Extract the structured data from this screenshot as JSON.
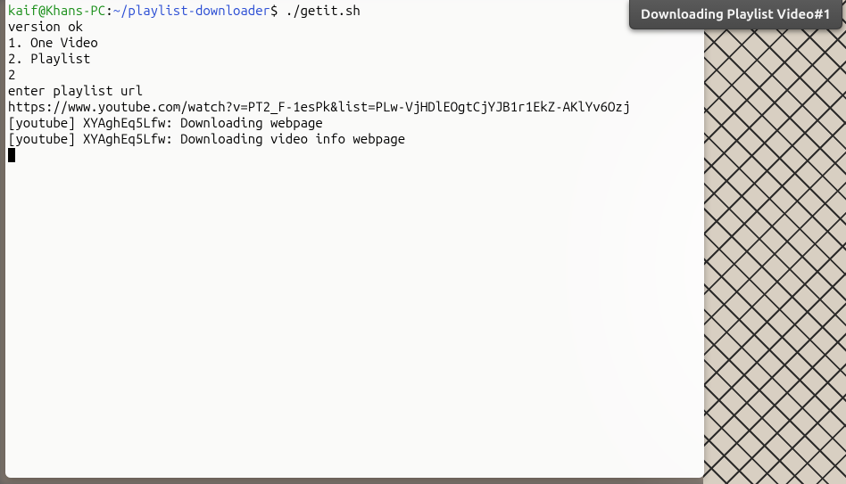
{
  "notification": {
    "title": "Downloading Playlist Video#1"
  },
  "terminal": {
    "prompt": {
      "user_host": "kaif@Khans-PC",
      "separator": ":",
      "path": "~/playlist-downloader",
      "dollar": "$"
    },
    "command": " ./getit.sh",
    "output": {
      "line_version": "version ok",
      "line_opt1": "1. One Video",
      "line_opt2": "2. Playlist",
      "line_choice": "2",
      "line_prompt_url": "enter playlist url",
      "line_url": "https://www.youtube.com/watch?v=PT2_F-1esPk&list=PLw-VjHDlEOgtCjYJB1r1EkZ-AKlYv6Ozj",
      "line_yt1": "[youtube] XYAghEq5Lfw: Downloading webpage",
      "line_yt2": "[youtube] XYAghEq5Lfw: Downloading video info webpage"
    }
  }
}
